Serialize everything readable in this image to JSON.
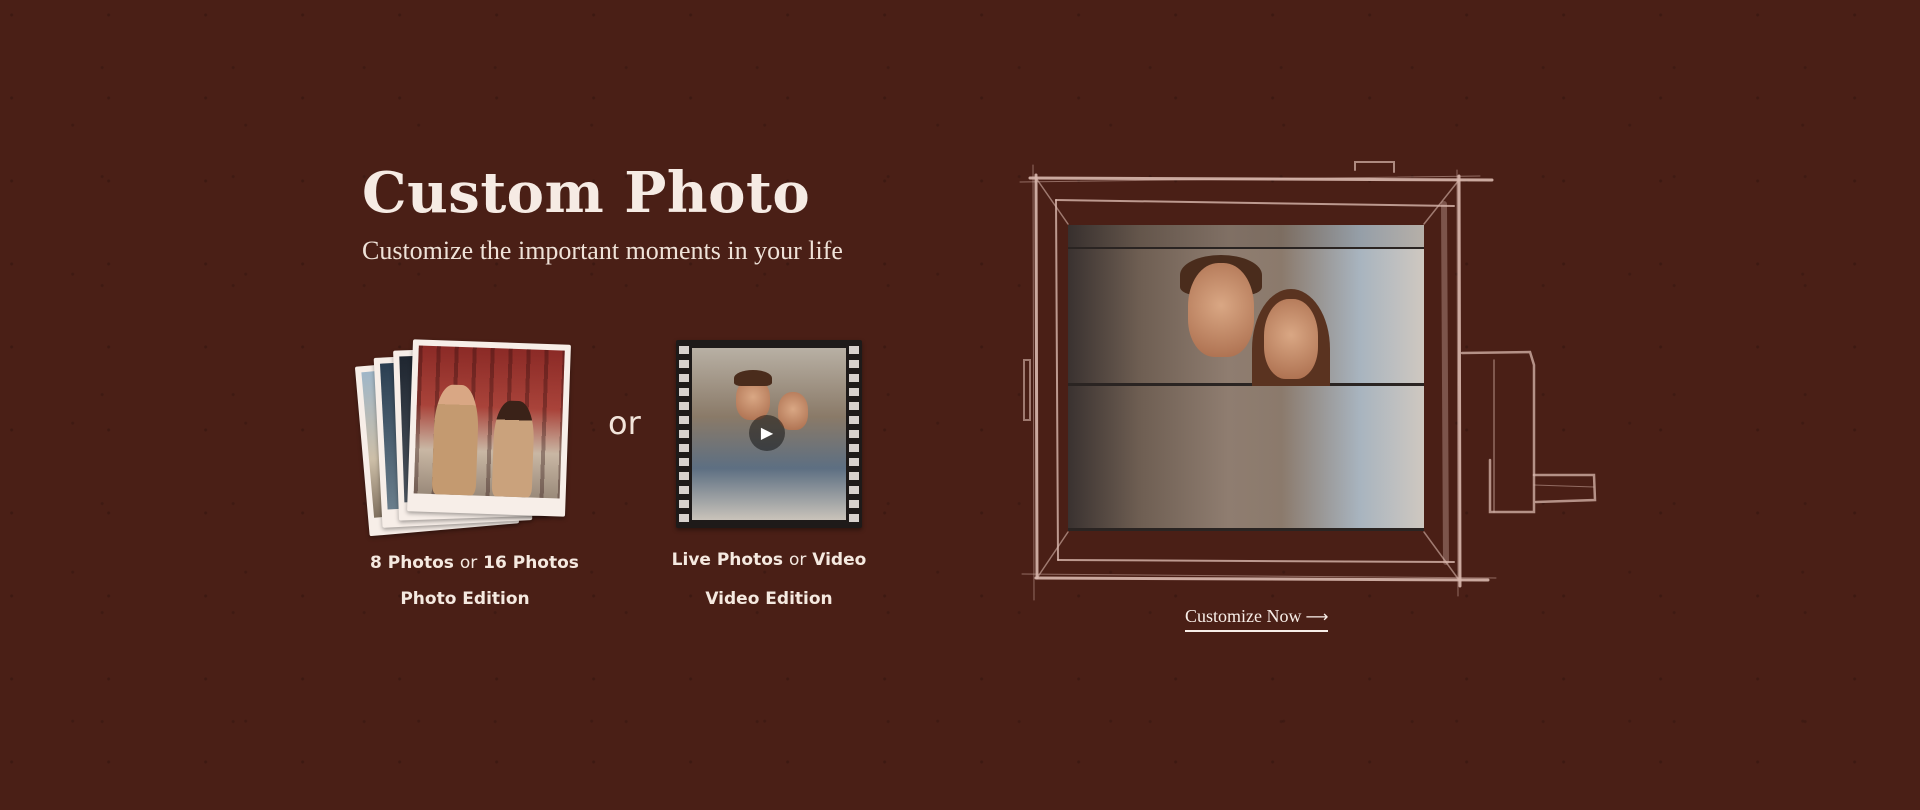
{
  "hero": {
    "title": "Custom Photo",
    "subtitle": "Customize the important moments in your life"
  },
  "options": {
    "photo": {
      "count_a": "8 Photos",
      "or": "or",
      "count_b": "16 Photos",
      "edition": "Photo Edition"
    },
    "separator": "or",
    "video": {
      "type_a": "Live Photos",
      "or": "or",
      "type_b": "Video",
      "edition": "Video Edition"
    }
  },
  "cta": {
    "label": "Customize Now",
    "arrow": "⟶"
  },
  "icons": {
    "play": "play-icon",
    "arrow": "arrow-right-icon"
  },
  "colors": {
    "background": "#4a1f16",
    "text": "#f3e6dc",
    "sketch": "#d9b8ae"
  }
}
